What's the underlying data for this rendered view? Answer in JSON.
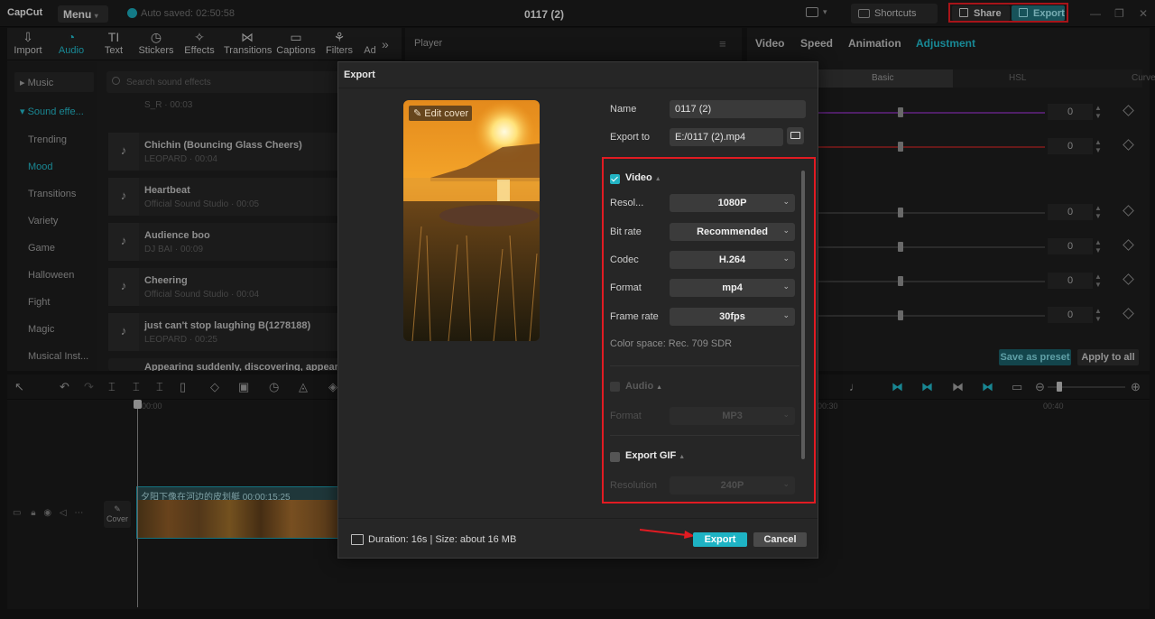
{
  "app": {
    "logo": "CapCut",
    "menu": "Menu",
    "autosave": "Auto saved: 02:50:58",
    "title": "0117 (2)",
    "shortcuts": "Shortcuts",
    "share": "Share",
    "export": "Export"
  },
  "toolbar": {
    "items": [
      {
        "label": "Import",
        "icon": "⇩"
      },
      {
        "label": "Audio",
        "icon": "◔"
      },
      {
        "label": "Text",
        "icon": "TI"
      },
      {
        "label": "Stickers",
        "icon": "◷"
      },
      {
        "label": "Effects",
        "icon": "✧"
      },
      {
        "label": "Transitions",
        "icon": "⋈"
      },
      {
        "label": "Captions",
        "icon": "▭"
      },
      {
        "label": "Filters",
        "icon": "⚘"
      },
      {
        "label": "Ad",
        "icon": ""
      }
    ]
  },
  "categories": {
    "music": "Music",
    "sound_effects": "Sound effe...",
    "items": [
      "Trending",
      "Mood",
      "Transitions",
      "Variety",
      "Game",
      "Halloween",
      "Fight",
      "Magic",
      "Musical Inst..."
    ]
  },
  "search": {
    "placeholder": "Search sound effects"
  },
  "sounds": [
    {
      "name": "S_R · 00:03",
      "meta": ""
    },
    {
      "name": "Chichin (Bouncing Glass Cheers)",
      "meta": "LEOPARD · 00:04"
    },
    {
      "name": "Heartbeat",
      "meta": "Official Sound Studio · 00:05"
    },
    {
      "name": "Audience boo",
      "meta": "DJ BAI · 00:09"
    },
    {
      "name": "Cheering",
      "meta": "Official Sound Studio · 00:04"
    },
    {
      "name": "just can't stop laughing B(1278188)",
      "meta": "LEOPARD · 00:25"
    },
    {
      "name": "Appearing suddenly, discovering, appear...",
      "meta": ""
    }
  ],
  "player": {
    "label": "Player"
  },
  "right_panel": {
    "tabs": [
      "Video",
      "Speed",
      "Animation",
      "Adjustment"
    ],
    "subtabs": [
      "Basic",
      "HSL",
      "Curves"
    ],
    "values": [
      "0",
      "0",
      "0",
      "0",
      "0",
      "0"
    ],
    "save_preset": "Save as preset",
    "apply_all": "Apply to all"
  },
  "timeline": {
    "ruler": [
      "00:00",
      "00:30",
      "00:40"
    ],
    "clip_label": "夕阳下像在河边的皮划艇  00:00:15:25",
    "cover": "Cover"
  },
  "export_dialog": {
    "title": "Export",
    "edit_cover": "Edit cover",
    "name_label": "Name",
    "name_value": "0117 (2)",
    "export_to_label": "Export to",
    "export_to_value": "E:/0117 (2).mp4",
    "video": {
      "title": "Video",
      "checked": true,
      "rows": [
        {
          "label": "Resol...",
          "value": "1080P"
        },
        {
          "label": "Bit rate",
          "value": "Recommended"
        },
        {
          "label": "Codec",
          "value": "H.264"
        },
        {
          "label": "Format",
          "value": "mp4"
        },
        {
          "label": "Frame rate",
          "value": "30fps"
        }
      ],
      "color_space": "Color space: Rec. 709 SDR"
    },
    "audio": {
      "title": "Audio",
      "checked": false,
      "format_label": "Format",
      "format_value": "MP3"
    },
    "gif": {
      "title": "Export GIF",
      "checked": false,
      "resolution_label": "Resolution",
      "resolution_value": "240P"
    },
    "duration": "Duration: 16s | Size: about 16 MB",
    "export_button": "Export",
    "cancel_button": "Cancel"
  },
  "colors": {
    "accent": "#1eb3c4",
    "highlight_box": "#e11b22"
  }
}
